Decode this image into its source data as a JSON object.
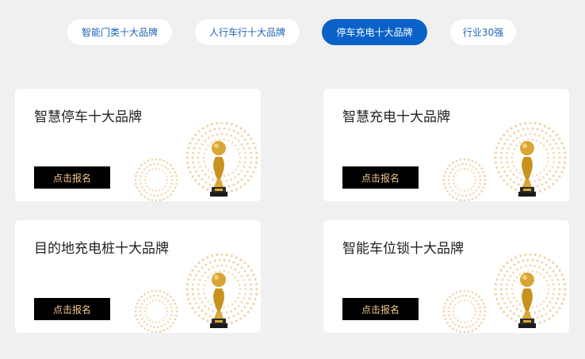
{
  "tabs": [
    {
      "label": "智能门类十大品牌",
      "active": false
    },
    {
      "label": "人行车行十大品牌",
      "active": false
    },
    {
      "label": "停车充电十大品牌",
      "active": true
    },
    {
      "label": "行业30强",
      "active": false
    }
  ],
  "cards": [
    {
      "title": "智慧停车十大品牌",
      "button": "点击报名"
    },
    {
      "title": "智慧充电十大品牌",
      "button": "点击报名"
    },
    {
      "title": "目的地充电桩十大品牌",
      "button": "点击报名"
    },
    {
      "title": "智能车位锁十大品牌",
      "button": "点击报名"
    }
  ],
  "colors": {
    "active_tab": "#0a62c9",
    "tab_text": "#1f63b8",
    "button_bg": "#000000",
    "button_text": "#f3c991",
    "dots": "#f0cfa4",
    "trophy_gold": "#d9a534"
  }
}
